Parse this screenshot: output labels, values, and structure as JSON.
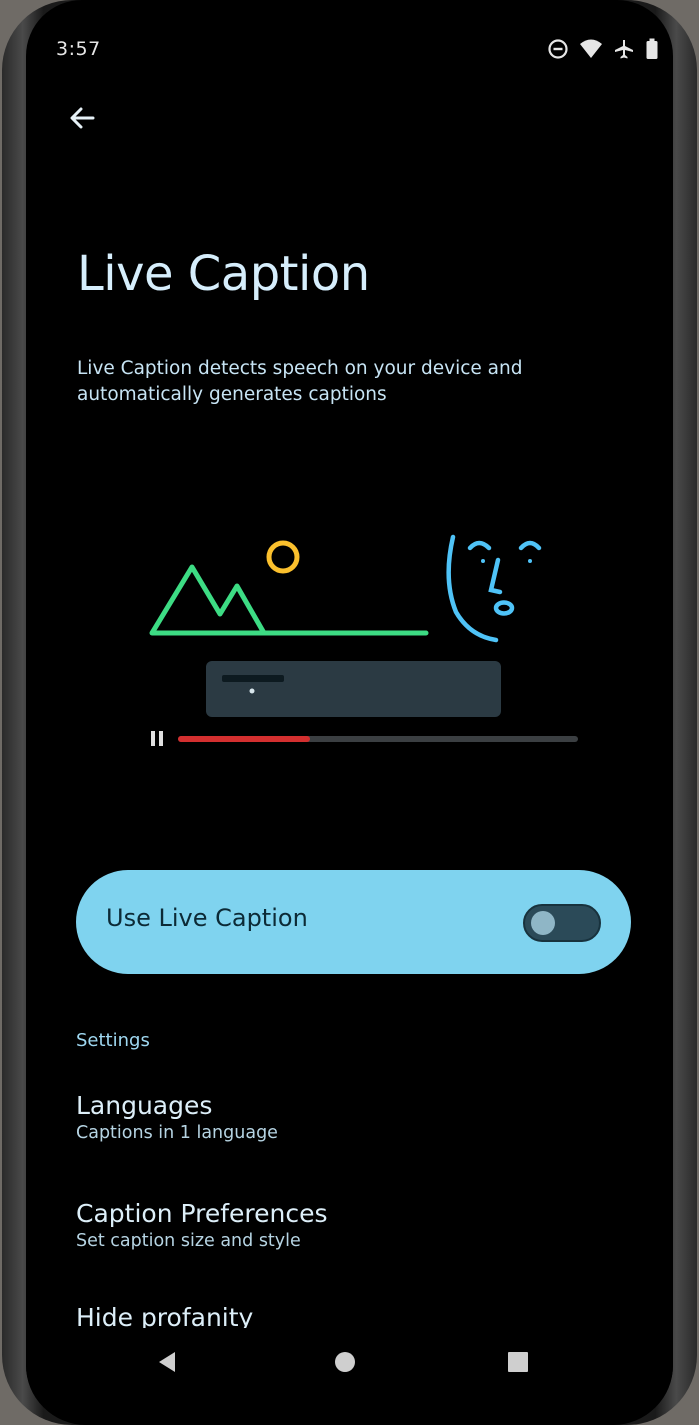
{
  "status_bar": {
    "time": "3:57",
    "icons": [
      "do-not-disturb-icon",
      "wifi-icon",
      "airplane-mode-icon",
      "battery-icon"
    ]
  },
  "header": {
    "back_icon": "arrow-back-icon",
    "title": "Live Caption",
    "description": "Live Caption detects speech on your device and automatically generates captions"
  },
  "illustration": {
    "mountain_color": "#3ddc84",
    "sun_color": "#fbc02d",
    "face_color": "#4fc3f7",
    "progress_color": "#d32f2f",
    "progress_fraction": 0.33
  },
  "toggle": {
    "label": "Use Live Caption",
    "checked": false,
    "card_color": "#7fd3ef"
  },
  "settings": {
    "section_title": "Settings",
    "items": [
      {
        "title": "Languages",
        "subtitle": "Captions in 1 language"
      },
      {
        "title": "Caption Preferences",
        "subtitle": "Set caption size and style"
      },
      {
        "title": "Hide profanity"
      }
    ]
  },
  "nav_bar": {
    "icons": [
      "nav-back-icon",
      "nav-home-icon",
      "nav-recents-icon"
    ]
  }
}
